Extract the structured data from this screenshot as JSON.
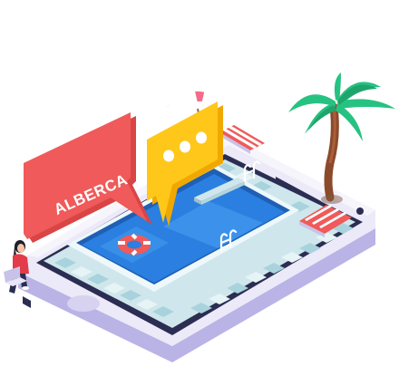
{
  "illustration": {
    "speech_bubble_label": "ALBERCA",
    "typing_bubble_dots": 3,
    "icons": [
      "smartphone-icon",
      "pool-icon",
      "speech-bubble-icon",
      "typing-bubble-icon",
      "life-ring-icon",
      "palm-tree-icon",
      "beach-umbrella-icon",
      "sun-lounger-icon",
      "diving-board-icon",
      "pool-ladder-icon",
      "person-with-laptop-icon"
    ],
    "colors": {
      "phone_body": "#e9e6f7",
      "phone_side": "#b9b3e6",
      "phone_screen_border": "#2b2d52",
      "pool_water": "#2a7fe0",
      "pool_water_light": "#4aa3f2",
      "tile_light": "#cfe7ec",
      "tile_mid": "#a9d3dc",
      "speech_bubble": "#f05a5a",
      "typing_bubble": "#ffc71a",
      "palm_leaves": "#26c281",
      "palm_trunk": "#8b4a2b",
      "umbrella": "#f26b8a",
      "life_ring": "#f05a5a"
    }
  }
}
